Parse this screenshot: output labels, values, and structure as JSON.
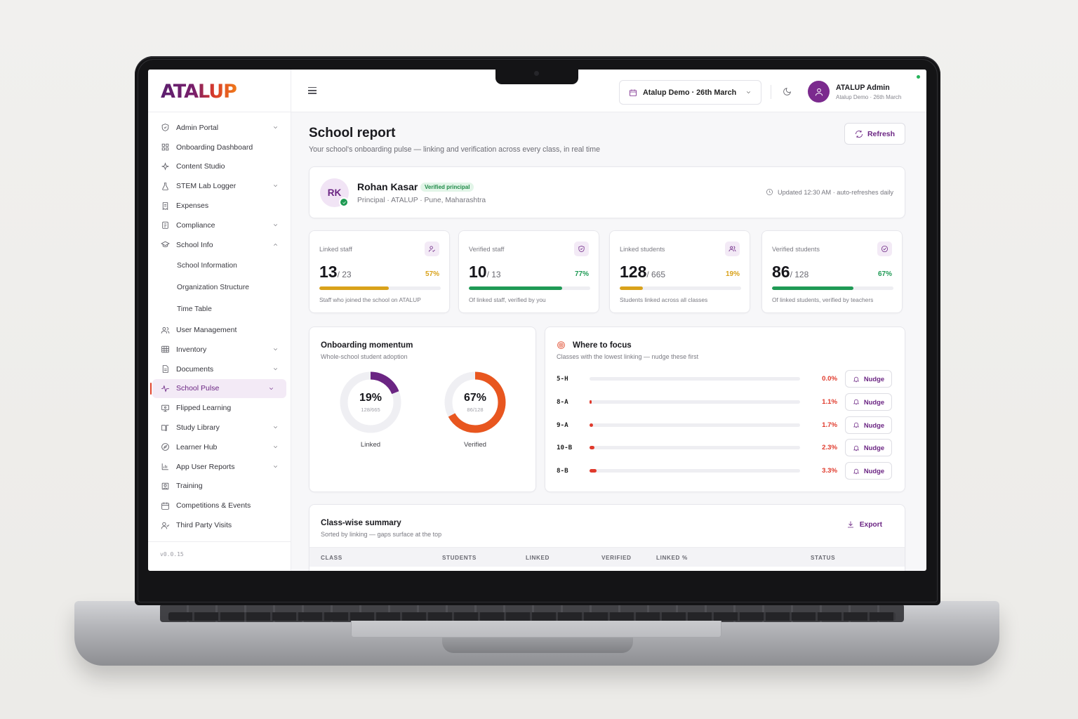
{
  "brand": {
    "logo_text": "ATALUP"
  },
  "sidebar": {
    "items": [
      {
        "label": "Admin Portal",
        "icon": "shield-icon",
        "chevron": "down"
      },
      {
        "label": "Onboarding Dashboard",
        "icon": "grid-icon"
      },
      {
        "label": "Content Studio",
        "icon": "sparkle-icon"
      },
      {
        "label": "STEM Lab Logger",
        "icon": "flask-icon",
        "chevron": "down"
      },
      {
        "label": "Expenses",
        "icon": "receipt-icon"
      },
      {
        "label": "Compliance",
        "icon": "clipboard-icon",
        "chevron": "down"
      },
      {
        "label": "School Info",
        "icon": "graduation-cap-icon",
        "chevron": "up"
      }
    ],
    "school_info_sub": [
      "School Information",
      "Organization Structure",
      "Time Table"
    ],
    "items_after": [
      {
        "label": "User Management",
        "icon": "users-icon"
      },
      {
        "label": "Inventory",
        "icon": "table-icon",
        "chevron": "down"
      },
      {
        "label": "Documents",
        "icon": "document-icon",
        "chevron": "down"
      },
      {
        "label": "School Pulse",
        "icon": "pulse-icon",
        "chevron": "down",
        "active": true
      },
      {
        "label": "Flipped Learning",
        "icon": "monitor-icon"
      },
      {
        "label": "Study Library",
        "icon": "book-icon",
        "chevron": "down"
      },
      {
        "label": "Learner Hub",
        "icon": "compass-icon",
        "chevron": "down"
      },
      {
        "label": "App User Reports",
        "icon": "bar-chart-icon",
        "chevron": "down"
      },
      {
        "label": "Training",
        "icon": "training-icon"
      },
      {
        "label": "Competitions & Events",
        "icon": "calendar-icon"
      },
      {
        "label": "Third Party Visits",
        "icon": "user-pair-icon"
      }
    ],
    "version": "v0.0.15"
  },
  "header": {
    "school_select": "Atalup Demo · 26th March",
    "user_name": "ATALUP Admin",
    "user_sub": "Atalup Demo · 26th March"
  },
  "page": {
    "title": "School report",
    "subtitle": "Your school's onboarding pulse — linking and verification across every class, in real time",
    "refresh_label": "Refresh"
  },
  "principal": {
    "initials": "RK",
    "name": "Rohan Kasar",
    "badge": "Verified principal",
    "meta": "Principal · ATALUP · Pune, Maharashtra",
    "updated": "Updated 12:30 AM · auto-refreshes daily"
  },
  "stats": [
    {
      "label": "Linked staff",
      "value": "13",
      "of": "/ 23",
      "pct": "57%",
      "progress": 0.57,
      "color": "#d9a21b",
      "note": "Staff who joined the school on ATALUP",
      "icon": "user-add-icon"
    },
    {
      "label": "Verified staff",
      "value": "10",
      "of": "/ 13",
      "pct": "77%",
      "progress": 0.77,
      "color": "#1f9a55",
      "note": "Of linked staff, verified by you",
      "icon": "shield-check-icon"
    },
    {
      "label": "Linked students",
      "value": "128",
      "of": "/ 665",
      "pct": "19%",
      "progress": 0.19,
      "color": "#d9a21b",
      "note": "Students linked across all classes",
      "icon": "users-icon"
    },
    {
      "label": "Verified students",
      "value": "86",
      "of": "/ 128",
      "pct": "67%",
      "progress": 0.67,
      "color": "#1f9a55",
      "note": "Of linked students, verified by teachers",
      "icon": "check-circle-icon"
    }
  ],
  "momentum": {
    "title": "Onboarding momentum",
    "subtitle": "Whole-school student adoption",
    "donuts": [
      {
        "value": "19%",
        "fraction": "128/665",
        "label": "Linked",
        "progress": 0.19,
        "color": "#6b2583"
      },
      {
        "value": "67%",
        "fraction": "86/128",
        "label": "Verified",
        "progress": 0.67,
        "color": "#e8561f"
      }
    ]
  },
  "focus": {
    "title": "Where to focus",
    "subtitle": "Classes with the lowest linking — nudge these first",
    "nudge_label": "Nudge",
    "rows": [
      {
        "cls": "5-H",
        "pct": "0.0%",
        "progress": 0.0
      },
      {
        "cls": "8-A",
        "pct": "1.1%",
        "progress": 0.011
      },
      {
        "cls": "9-A",
        "pct": "1.7%",
        "progress": 0.017
      },
      {
        "cls": "10-B",
        "pct": "2.3%",
        "progress": 0.023
      },
      {
        "cls": "8-B",
        "pct": "3.3%",
        "progress": 0.033
      }
    ]
  },
  "summary": {
    "title": "Class-wise summary",
    "subtitle": "Sorted by linking — gaps surface at the top",
    "export_label": "Export",
    "columns": [
      "CLASS",
      "STUDENTS",
      "LINKED",
      "VERIFIED",
      "LINKED %",
      "STATUS"
    ]
  }
}
